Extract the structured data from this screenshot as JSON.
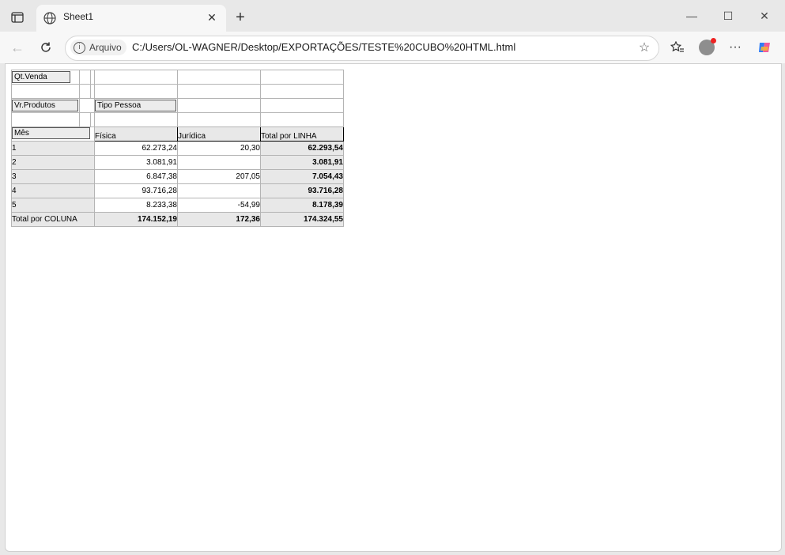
{
  "browser": {
    "tab_title": "Sheet1",
    "address_badge": "Arquivo",
    "url": "C:/Users/OL-WAGNER/Desktop/EXPORTAÇÕES/TESTE%20CUBO%20HTML.html"
  },
  "pivot": {
    "data_field": "Qt.Venda",
    "value_field": "Vr.Produtos",
    "column_field": "Tipo Pessoa",
    "row_field": "Mês",
    "column_headers": [
      "Física",
      "Jurídica",
      "Total por LINHA"
    ],
    "rows": [
      {
        "label": "1",
        "fisica": "62.273,24",
        "juridica": "20,30",
        "total": "62.293,54"
      },
      {
        "label": "2",
        "fisica": "3.081,91",
        "juridica": "",
        "total": "3.081,91"
      },
      {
        "label": "3",
        "fisica": "6.847,38",
        "juridica": "207,05",
        "total": "7.054,43"
      },
      {
        "label": "4",
        "fisica": "93.716,28",
        "juridica": "",
        "total": "93.716,28"
      },
      {
        "label": "5",
        "fisica": "8.233,38",
        "juridica": "-54,99",
        "total": "8.178,39"
      }
    ],
    "total_row": {
      "label": "Total por COLUNA",
      "fisica": "174.152,19",
      "juridica": "172,36",
      "total": "174.324,55"
    }
  }
}
